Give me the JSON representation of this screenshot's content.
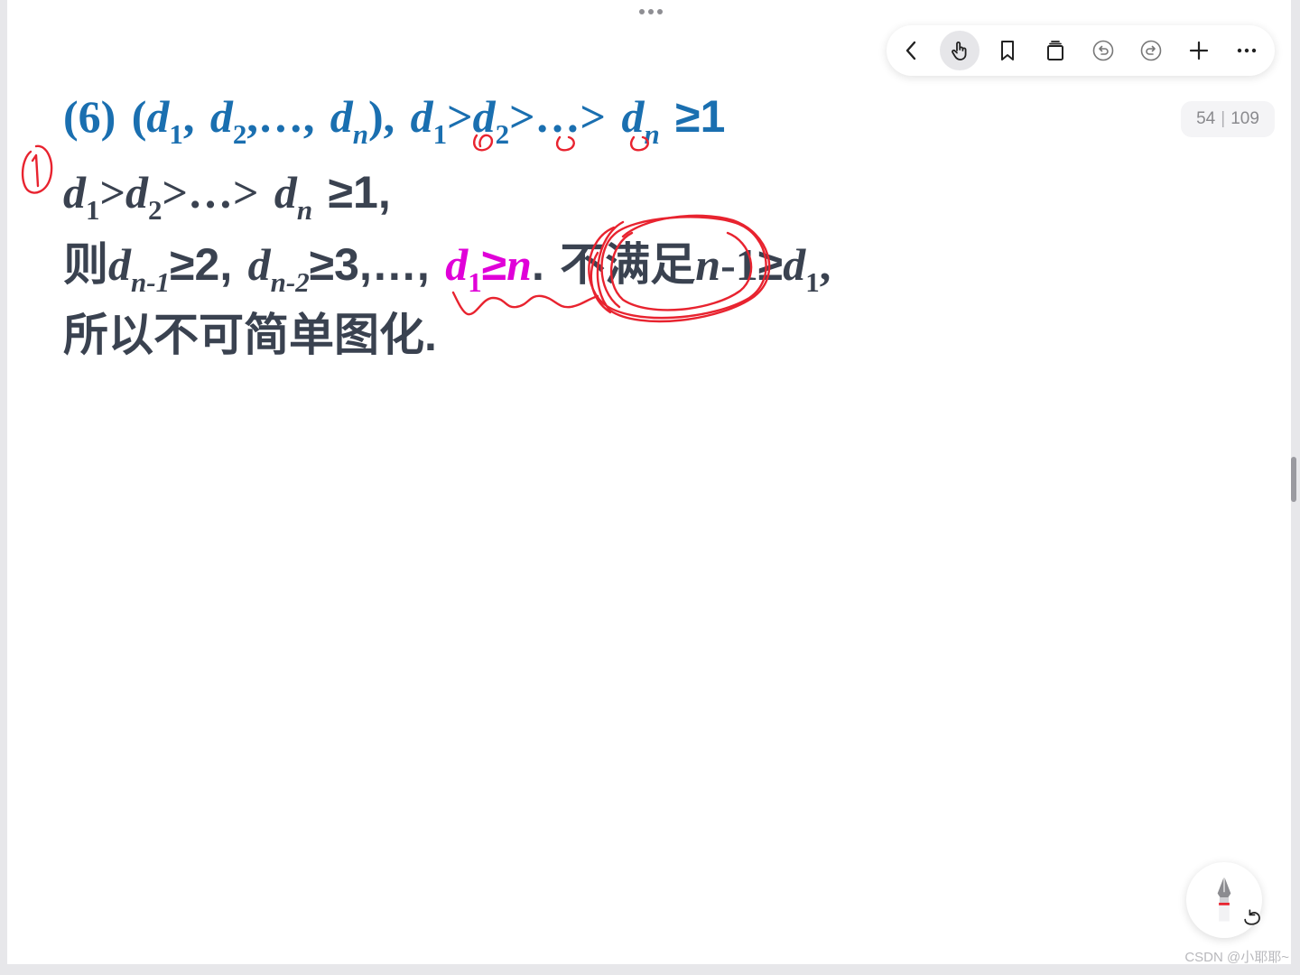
{
  "toolbar": {
    "buttons": [
      {
        "name": "back",
        "icon": "chevron-left-icon"
      },
      {
        "name": "hand",
        "icon": "hand-pointer-icon",
        "active": true
      },
      {
        "name": "bookmark",
        "icon": "bookmark-icon"
      },
      {
        "name": "pages",
        "icon": "page-stack-icon"
      },
      {
        "name": "undo",
        "icon": "undo-icon"
      },
      {
        "name": "redo",
        "icon": "redo-icon"
      },
      {
        "name": "add",
        "icon": "plus-icon"
      },
      {
        "name": "more",
        "icon": "more-icon"
      }
    ]
  },
  "page_indicator": {
    "current": "54",
    "total": "109"
  },
  "content": {
    "line1": {
      "num": "(6)",
      "open": "(",
      "d": "d",
      "sub1": "1",
      "sub2": "2",
      "subn": "n",
      "comma": ",",
      "ellipsis_comma": ",…,",
      "close": "),",
      "gt": ">",
      "gt_ellipsis": ">…>",
      "geq_one": "≥1"
    },
    "line2": {
      "d": "d",
      "sub1": "1",
      "sub2": "2",
      "subn": "n",
      "gt": ">",
      "gt_ellipsis": ">…>",
      "geq_one": "≥1,"
    },
    "line3": {
      "then": "则",
      "d": "d",
      "sub_n1": "n-1",
      "geq2": "≥2,",
      "sub_n2": "n-2",
      "geq3": "≥3,…,",
      "sub1": "1",
      "geq": "≥",
      "n": "n",
      "dot": ".",
      "not_satisfy": "不满足",
      "n_minus_1": "n",
      "minus1": "-1",
      "geq_sym": "≥",
      "trail": ","
    },
    "line4": {
      "text": "所以不可简单图化."
    }
  },
  "colors": {
    "blue": "#1a6fb0",
    "gray": "#3a4250",
    "magenta": "#e000d8",
    "ink_red": "#e8232f"
  },
  "watermark": "CSDN @小耶耶~"
}
